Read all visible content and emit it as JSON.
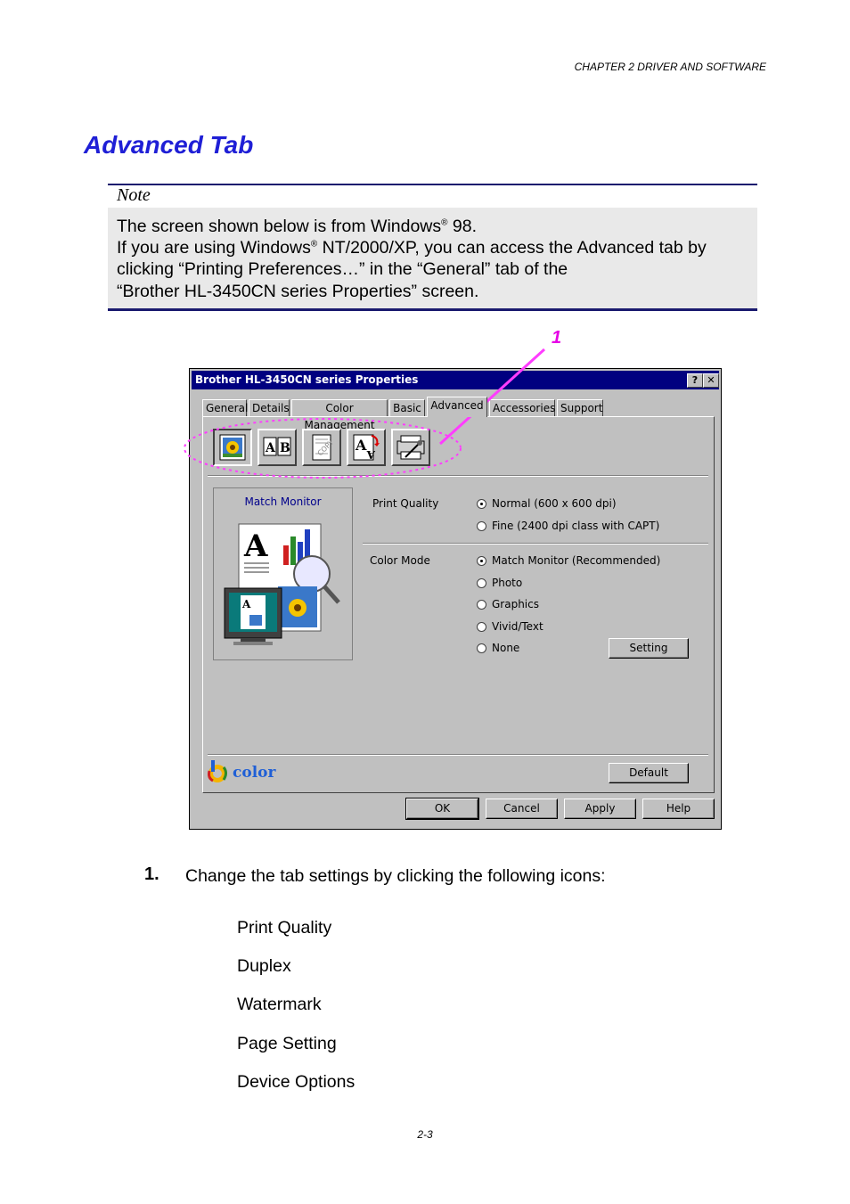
{
  "header": {
    "chapter": "CHAPTER 2 DRIVER AND SOFTWARE"
  },
  "section_title": "Advanced Tab",
  "note": {
    "label": "Note",
    "line1_pre": "The screen shown below is from Windows",
    "line1_sup": "®",
    "line1_post": " 98.",
    "line2_pre": "If you are using Windows",
    "line2_sup": "®",
    "line2_post": " NT/2000/XP, you can access the Advanced tab by",
    "line3": "clicking “Printing Preferences…” in the “General” tab of the",
    "line4": "“Brother HL-3450CN series Properties” screen."
  },
  "callout_number": "1",
  "dialog": {
    "title": "Brother HL-3450CN series Properties",
    "help_glyph": "?",
    "close_glyph": "✕",
    "tabs": [
      "General",
      "Details",
      "Color Management",
      "Basic",
      "Advanced",
      "Accessories",
      "Support"
    ],
    "active_tab": "Advanced",
    "preview_label": "Match Monitor",
    "print_quality_label": "Print Quality",
    "quality_options": [
      "Normal (600 x 600 dpi)",
      "Fine (2400 dpi class with CAPT)"
    ],
    "quality_selected": 0,
    "color_mode_label": "Color Mode",
    "color_options": [
      "Match Monitor (Recommended)",
      "Photo",
      "Graphics",
      "Vivid/Text",
      "None"
    ],
    "color_selected": 0,
    "setting_button": "Setting",
    "default_button": "Default",
    "logo_text": "color",
    "ok_button": "OK",
    "cancel_button": "Cancel",
    "apply_button": "Apply",
    "help_button": "Help"
  },
  "step": {
    "number": "1.",
    "text": "Change the tab settings by clicking the following icons:",
    "items": [
      "Print Quality",
      "Duplex",
      "Watermark",
      "Page Setting",
      "Device Options"
    ]
  },
  "footer": {
    "page": "2-3"
  },
  "colors": {
    "title_blue": "#1f1fd6",
    "callout_magenta": "#e600e6",
    "note_rule": "#1a1a6e",
    "titlebar": "#000080"
  }
}
